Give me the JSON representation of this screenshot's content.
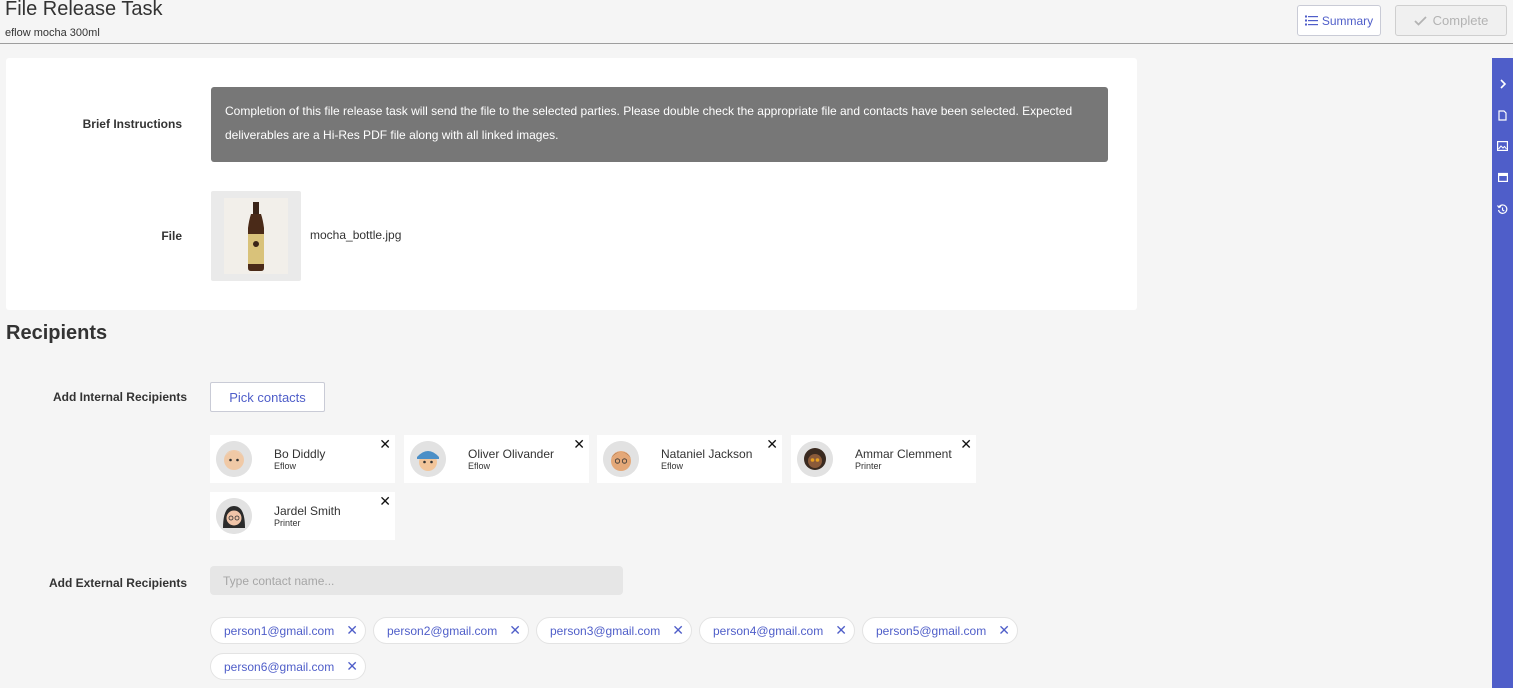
{
  "header": {
    "title": "File Release Task",
    "subtitle": "eflow mocha 300ml",
    "summary_label": "Summary",
    "complete_label": "Complete"
  },
  "brief": {
    "label": "Brief Instructions",
    "text": "Completion of this file release task will send the file to the selected parties. Please double check the appropriate file and contacts have been selected. Expected deliverables are a Hi-Res PDF file along with all linked images."
  },
  "file": {
    "label": "File",
    "name": "mocha_bottle.jpg"
  },
  "recipients": {
    "title": "Recipients",
    "internal_label": "Add Internal Recipients",
    "pick_label": "Pick contacts",
    "contacts": [
      {
        "name": "Bo Diddly",
        "org": "Eflow"
      },
      {
        "name": "Oliver Olivander",
        "org": "Eflow"
      },
      {
        "name": "Nataniel Jackson",
        "org": "Eflow"
      },
      {
        "name": "Ammar Clemment",
        "org": "Printer"
      },
      {
        "name": "Jardel Smith",
        "org": "Printer"
      }
    ],
    "external_label": "Add External Recipients",
    "external_placeholder": "Type contact name...",
    "emails": [
      "person1@gmail.com",
      "person2@gmail.com",
      "person3@gmail.com",
      "person4@gmail.com",
      "person5@gmail.com",
      "person6@gmail.com"
    ]
  },
  "icons": {
    "close": "✕",
    "rail": [
      "chevron-right-icon",
      "file-icon",
      "image-icon",
      "calendar-icon",
      "history-icon"
    ]
  },
  "colors": {
    "accent": "#4f5ec9",
    "instructions_bg": "#777777",
    "rail_bg": "#4f5ec9"
  }
}
